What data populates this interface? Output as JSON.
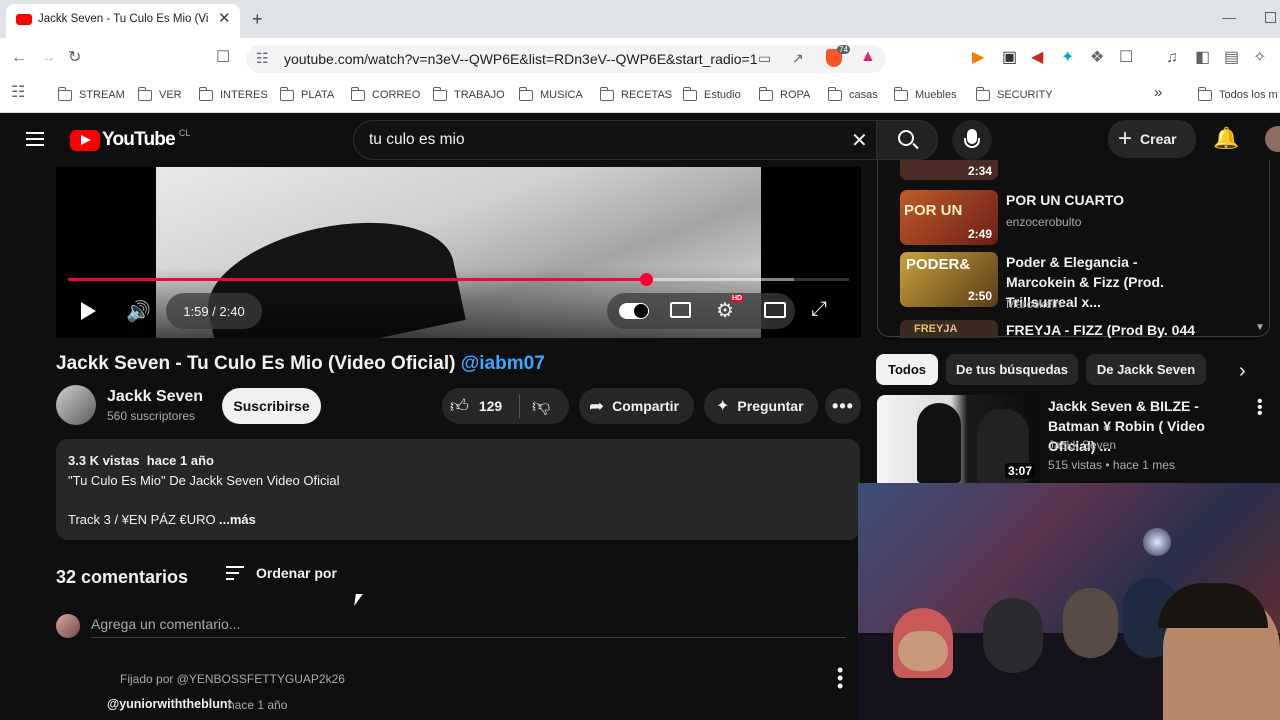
{
  "browser": {
    "tab_title": "Jackk Seven - Tu Culo Es Mio (Video",
    "url": "youtube.com/watch?v=n3eV--QWP6E&list=RDn3eV--QWP6E&start_radio=1",
    "bookmarks": [
      "STREAM",
      "VER",
      "INTERES",
      "PLATA",
      "CORREO",
      "TRABAJO",
      "MUSICA",
      "RECETAS",
      "Estudio",
      "ROPA",
      "casas",
      "Muebles",
      "SECURITY"
    ],
    "bookmarks_overflow": "Todos los m",
    "brave_badge": "74"
  },
  "yt": {
    "logo_text": "YouTube",
    "country": "CL",
    "search_value": "tu culo es mio",
    "create_label": "Crear",
    "player": {
      "time": "1:59 / 2:40",
      "progress": 0.74,
      "buffered": 0.93,
      "hd_badge": "HD"
    },
    "video_title": "Jackk Seven - Tu Culo Es Mio (Video Oficial)",
    "title_handle": "@iabm07",
    "channel_name": "Jackk Seven",
    "subscribers": "560 suscriptores",
    "subscribe_label": "Suscribirse",
    "likes": "129",
    "share_label": "Compartir",
    "ask_label": "Preguntar",
    "description": {
      "stats": "3.3 K vistas  hace 1 año",
      "line1": "\"Tu Culo Es Mio\" De Jackk Seven Video Oficial",
      "line2": "Track 3 / ¥EN PÁZ €URO",
      "more": "...más"
    },
    "comments": {
      "count": "32 comentarios",
      "sort_label": "Ordenar por",
      "add_placeholder": "Agrega un comentario...",
      "pinned": "Fijado por @YENBOSSFETTYGUAP2k26",
      "first_author": "@yuniorwiththeblunt",
      "first_time": "hace 1 año"
    },
    "playlist": [
      {
        "title": "POR UN CUARTO",
        "channel": "enzocerobulto",
        "duration": "2:49",
        "thumb_text": "POR UN"
      },
      {
        "title": "Poder & Elegancia - Marcokein & Fizz (Prod. Trillsurreal x...",
        "channel": "Marcokein",
        "duration": "2:50",
        "thumb_text": "PODER&"
      },
      {
        "title": "FREYJA - FIZZ (Prod By. 044 &",
        "channel": "",
        "duration": "",
        "thumb_text": "FREYJA"
      }
    ],
    "playlist_prev_duration": "2:34",
    "chips": [
      "Todos",
      "De tus búsquedas",
      "De Jackk Seven"
    ],
    "recommended": {
      "title": "Jackk Seven & BILZE - Batman ¥ Robin ( Video Oficial) ...",
      "channel": "Jackk Seven",
      "meta": "515 vistas • hace 1 mes",
      "duration": "3:07"
    }
  }
}
